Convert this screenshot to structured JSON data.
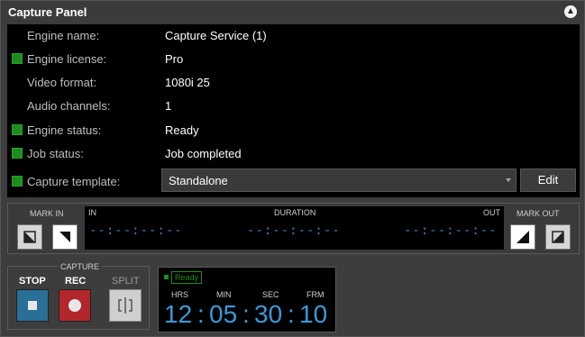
{
  "panel": {
    "title": "Capture Panel",
    "collapse_icon": "chevron-up-icon"
  },
  "info": {
    "engine_name_label": "Engine name:",
    "engine_name_value": "Capture Service (1)",
    "engine_license_label": "Engine license:",
    "engine_license_value": "Pro",
    "video_format_label": "Video format:",
    "video_format_value": "1080i 25",
    "audio_channels_label": "Audio channels:",
    "audio_channels_value": "1",
    "engine_status_label": "Engine status:",
    "engine_status_value": "Ready",
    "job_status_label": "Job status:",
    "job_status_value": "Job completed",
    "capture_template_label": "Capture template:",
    "capture_template_value": "Standalone",
    "edit_label": "Edit",
    "status_color": "#1e8c1e"
  },
  "marks": {
    "mark_in_label": "MARK IN",
    "mark_out_label": "MARK OUT",
    "in_label": "IN",
    "duration_label": "DURATION",
    "out_label": "OUT",
    "in_tc": "--:--:--:--",
    "duration_tc": "--:--:--:--",
    "out_tc": "--:--:--:--"
  },
  "capture": {
    "group_label": "CAPTURE",
    "stop_label": "STOP",
    "rec_label": "REC",
    "split_label": "SPLIT",
    "stop_color": "#2a6f97",
    "rec_color": "#b3262c"
  },
  "timer": {
    "status": "Ready",
    "hrs_label": "HRS",
    "min_label": "MIN",
    "sec_label": "SEC",
    "frm_label": "FRM",
    "hrs": "12",
    "min": "05",
    "sec": "30",
    "frm": "10"
  }
}
